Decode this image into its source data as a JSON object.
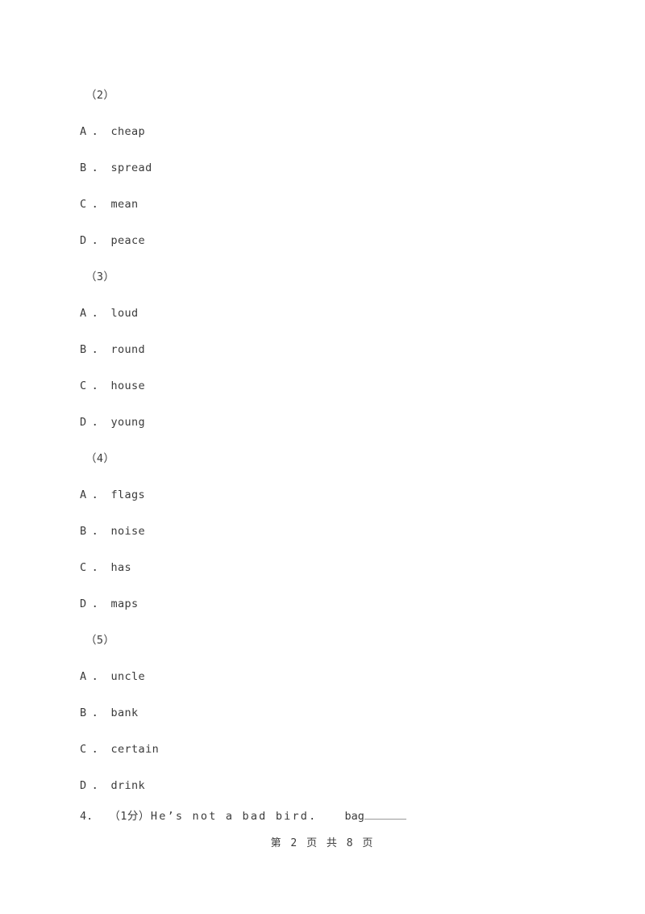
{
  "document": {
    "type": "exam-paper",
    "text_color": "#3b3b3b",
    "background_color": "#ffffff",
    "rule_color": "#9a9a9a"
  },
  "question_groups": [
    {
      "label": "（2）",
      "options": [
        {
          "letter": "A",
          "dot": "．",
          "text": "cheap"
        },
        {
          "letter": "B",
          "dot": "．",
          "text": "spread"
        },
        {
          "letter": "C",
          "dot": "．",
          "text": "mean"
        },
        {
          "letter": "D",
          "dot": "．",
          "text": "peace"
        }
      ]
    },
    {
      "label": "（3）",
      "options": [
        {
          "letter": "A",
          "dot": "．",
          "text": "loud"
        },
        {
          "letter": "B",
          "dot": "．",
          "text": "round"
        },
        {
          "letter": "C",
          "dot": "．",
          "text": "house"
        },
        {
          "letter": "D",
          "dot": "．",
          "text": "young"
        }
      ]
    },
    {
      "label": "（4）",
      "options": [
        {
          "letter": "A",
          "dot": "．",
          "text": "flags"
        },
        {
          "letter": "B",
          "dot": "．",
          "text": "noise"
        },
        {
          "letter": "C",
          "dot": "．",
          "text": "has"
        },
        {
          "letter": "D",
          "dot": "．",
          "text": "maps"
        }
      ]
    },
    {
      "label": "（5）",
      "options": [
        {
          "letter": "A",
          "dot": "．",
          "text": "uncle"
        },
        {
          "letter": "B",
          "dot": "．",
          "text": "bank"
        },
        {
          "letter": "C",
          "dot": "．",
          "text": "certain"
        },
        {
          "letter": "D",
          "dot": "．",
          "text": "drink"
        }
      ]
    }
  ],
  "question_4": {
    "number": "4.",
    "score": "（1分）",
    "stem": "He’s not a bad bird.",
    "answer_word": "bag",
    "blank": ""
  },
  "footer": {
    "text": "第 2 页 共 8 页"
  }
}
